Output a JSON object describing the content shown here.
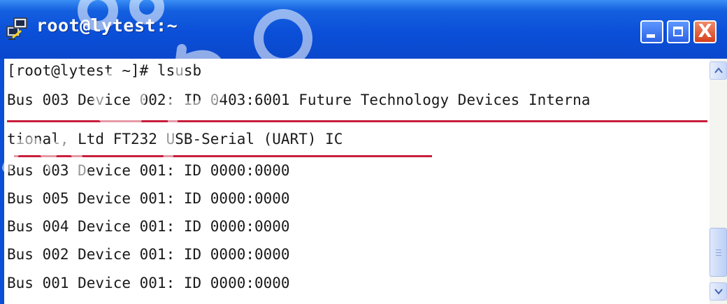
{
  "window": {
    "title": "root@lytest:~",
    "controls": {
      "minimize": "minimize",
      "maximize": "maximize",
      "close": "X"
    }
  },
  "terminal": {
    "lines": [
      "[root@lytest ~]# lsusb",
      "Bus 003 Device 002: ID 0403:6001 Future Technology Devices Interna",
      "tional, Ltd FT232 USB-Serial (UART) IC",
      "Bus 003 Device 001: ID 0000:0000",
      "Bus 005 Device 001: ID 0000:0000",
      "Bus 004 Device 001: ID 0000:0000",
      "Bus 002 Device 001: ID 0000:0000",
      "Bus 001 Device 001: ID 0000:0000"
    ]
  },
  "colors": {
    "titlebar": "#0a4fd6",
    "highlight_underline": "#c81e3c",
    "text": "#1a1a1a"
  },
  "icons": [
    "putty-terminal-icon",
    "minimize-icon",
    "maximize-icon",
    "close-icon",
    "scroll-up-icon",
    "scroll-down-icon"
  ]
}
